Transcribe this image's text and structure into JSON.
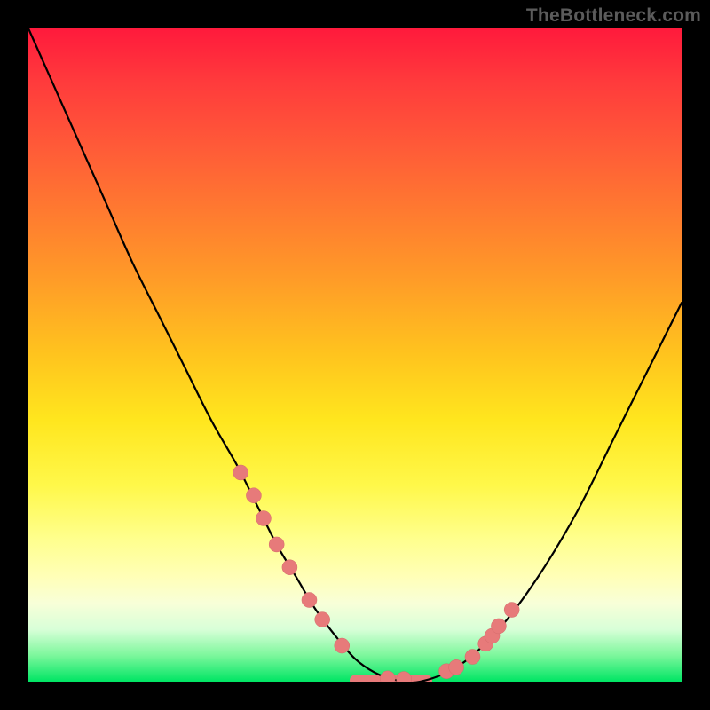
{
  "watermark": "TheBottleneck.com",
  "colors": {
    "dot": "#e77a7a",
    "line": "#000000"
  },
  "chart_data": {
    "type": "line",
    "title": "",
    "xlabel": "",
    "ylabel": "",
    "xlim": [
      0,
      100
    ],
    "ylim": [
      0,
      100
    ],
    "grid": false,
    "legend": false,
    "series": [
      {
        "name": "bottleneck-curve",
        "x": [
          0,
          4,
          8,
          12,
          16,
          20,
          24,
          28,
          32,
          35,
          38,
          41,
          44,
          47,
          50,
          53,
          56,
          60,
          66,
          72,
          78,
          84,
          90,
          96,
          100
        ],
        "values": [
          100,
          91,
          82,
          73,
          64,
          56,
          48,
          40,
          33,
          27,
          21,
          16,
          11,
          7,
          3.5,
          1.4,
          0.3,
          0,
          2.5,
          8,
          16,
          26,
          38,
          50,
          58
        ]
      }
    ],
    "markers": {
      "name": "highlight-dots",
      "x": [
        32.5,
        34.5,
        36.0,
        38.0,
        40.0,
        43.0,
        45.0,
        48.0,
        55.0,
        57.5,
        64.0,
        65.5,
        68.0,
        70.0,
        71.0,
        72.0,
        74.0
      ],
      "values": [
        32.0,
        28.5,
        25.0,
        21.0,
        17.5,
        12.5,
        9.5,
        5.5,
        0.5,
        0.4,
        1.6,
        2.2,
        3.8,
        5.8,
        7.0,
        8.5,
        11.0
      ]
    },
    "flat_segment": {
      "x0": 50,
      "x1": 61,
      "y": 0.2
    }
  }
}
